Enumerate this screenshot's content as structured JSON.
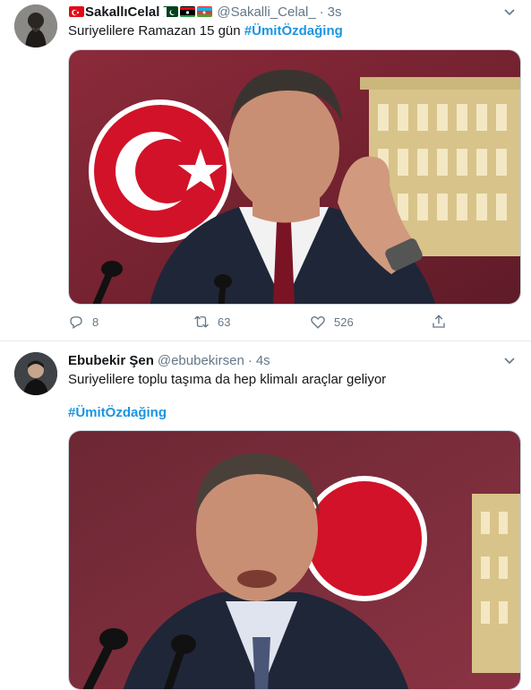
{
  "tweets": [
    {
      "user_name": "SakallıCelal",
      "handle": "@Sakalli_Celal_",
      "separator": "·",
      "time": "3s",
      "text": "Suriyelilere Ramazan 15 gün",
      "hashtag": "#ÜmitÖzdağing",
      "flags": [
        "turkey-flag",
        "pakistan-flag",
        "libya-flag",
        "azerbaijan-flag"
      ],
      "media": "photo-politician-gesturing-turkish-flag-parliament",
      "replies": "8",
      "retweets": "63",
      "likes": "526"
    },
    {
      "user_name": "Ebubekir Şen",
      "handle": "@ebubekirsen",
      "separator": "·",
      "time": "4s",
      "text": "Suriyelilere toplu taşıma da hep klimalı araçlar geliyor",
      "hashtag": "#ÜmitÖzdağing",
      "media": "photo-politician-speaking-microphones"
    }
  ],
  "colors": {
    "link": "#1b95e0",
    "secondary_text": "#657786",
    "border": "#e6ecf0",
    "photo_background": "#7a2a35"
  }
}
